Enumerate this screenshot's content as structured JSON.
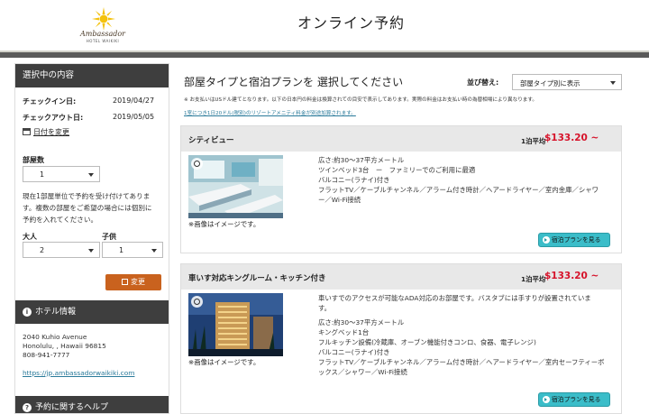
{
  "header": {
    "logo_name": "Ambassador",
    "logo_sub": "HOTEL WAIKIKI",
    "title": "オンライン予約"
  },
  "sidebar": {
    "selection_title": "選択中の内容",
    "checkin_label": "チェックイン日:",
    "checkin_value": "2019/04/27",
    "checkout_label": "チェックアウト日:",
    "checkout_value": "2019/05/05",
    "change_date": "日付を変更",
    "rooms_label": "部屋数",
    "rooms_value": "1",
    "notice_line1": "現在1部屋単位で予約を受け付けてありま",
    "notice_line2": "す。複数の部屋をご希望の場合には個別に",
    "notice_line3": "予約を入れてください。",
    "adults_label": "大人",
    "adults_value": "2",
    "children_label": "子供",
    "children_value": "1",
    "change_button": "変更",
    "hotel_info_title": "ホテル情報",
    "address_line1": "2040 Kuhio Avenue",
    "address_line2": "Honolulu, , Hawaii 96815",
    "phone": "808-941-7777",
    "hotel_url": "https://jp.ambassadorwaikiki.com",
    "help_title": "予約に関するヘルプ"
  },
  "main": {
    "title": "部屋タイプと宿泊プランを 選択してください",
    "sort_label": "並び替え:",
    "sort_value": "部屋タイプ別に表示",
    "disclaimer": "※ お支払いはUSドル建てとなります。以下の日本円の料金は換算されての目安で表示してあります。実際の料金はお支払い時の為替相場により異なります。",
    "resort_fee": "1室につき1日20ドル(税別)のリゾートアメニティ料金が別途加算されます。",
    "image_note": "※画像はイメージです。",
    "per_night_label": "1泊平均",
    "plan_button": "宿泊プランを見る",
    "rooms": [
      {
        "name": "シティビュー",
        "price": "$133.20 ~",
        "lines": [
          "広さ:約30〜37平方メートル",
          "ツインベッド3台　ー　ファミリーでのご利用に最適",
          "バルコニー(ラナイ)付き",
          "フラットTV／ケーブルチャンネル／アラーム付き時計／ヘアードライヤー／室内金庫／シャワ",
          "ー／Wi-Fi接続"
        ]
      },
      {
        "name": "車いす対応キングルーム・キッチン付き",
        "price": "$133.20 ~",
        "intro_line1": "車いすでのアクセスが可能なADA対応のお部屋です。バスタブには手すりが設置されていま",
        "intro_line2": "す。",
        "lines": [
          "広さ:約30〜37平方メートル",
          "キングベッド1台",
          "フルキッチン設備(冷蔵庫、オーブン機能付きコンロ、食器、電子レンジ)",
          "バルコニー(ラナイ)付き",
          "フラットTV／ケーブルチャンネル／アラーム付き時計／ヘアードライヤー／室内セーフティーボ",
          "ックス／シャワー／Wi-Fi接続"
        ]
      }
    ]
  }
}
